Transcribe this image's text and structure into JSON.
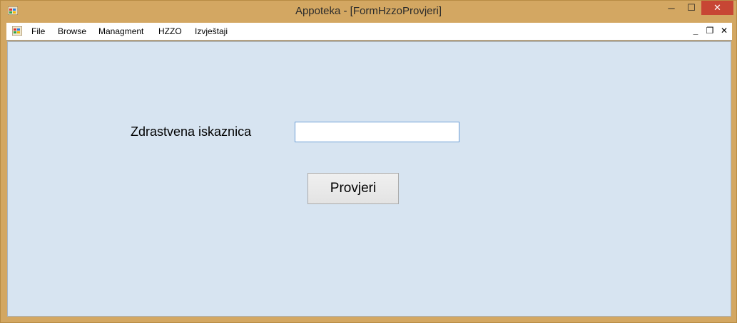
{
  "window": {
    "title": "Appoteka - [FormHzzoProvjeri]",
    "controls": {
      "minimize": "─",
      "maximize": "☐",
      "close": "✕"
    }
  },
  "menubar": {
    "items": [
      "File",
      "Browse",
      "Managment",
      "HZZO",
      "Izvještaji"
    ],
    "mdi_controls": {
      "minimize": "_",
      "restore": "❐",
      "close": "✕"
    }
  },
  "form": {
    "card_label": "Zdrastvena iskaznica",
    "card_value": "",
    "check_button": "Provjeri"
  },
  "colors": {
    "frame": "#d3a762",
    "client_background": "#d7e4f1",
    "close_button": "#c74634",
    "input_border": "#6e9fd6"
  },
  "icons": {
    "app": "app-icon",
    "menu": "mdi-child-icon"
  }
}
